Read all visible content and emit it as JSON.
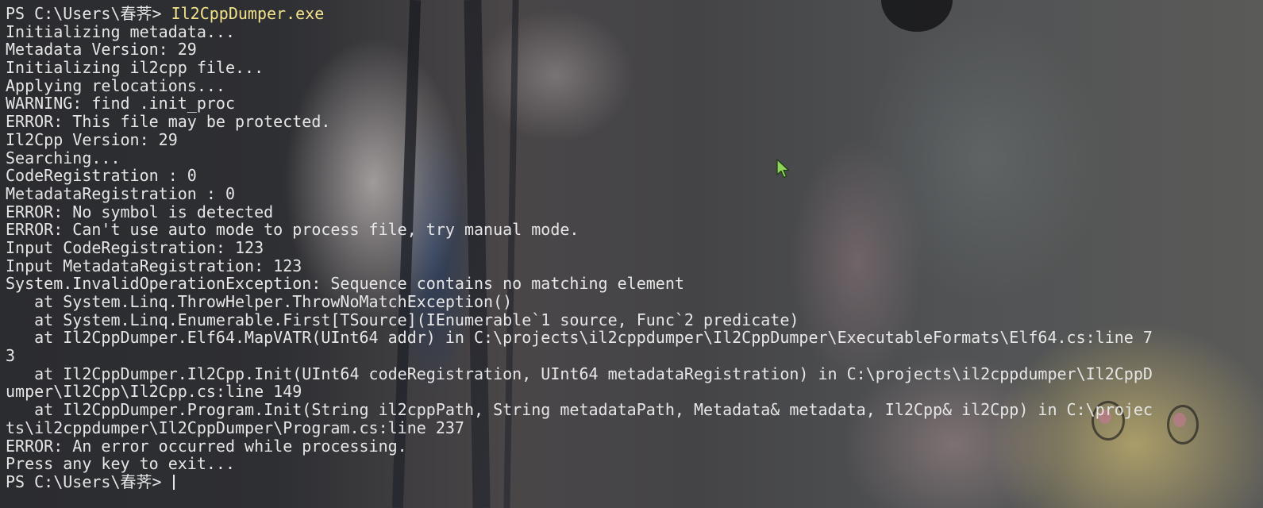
{
  "window": {
    "type": "PowerShell terminal"
  },
  "terminal": {
    "prompt": "PS C:\\Users\\春荠> ",
    "command": "Il2CppDumper.exe",
    "output": [
      "Initializing metadata...",
      "Metadata Version: 29",
      "Initializing il2cpp file...",
      "Applying relocations...",
      "WARNING: find .init_proc",
      "ERROR: This file may be protected.",
      "Il2Cpp Version: 29",
      "Searching...",
      "CodeRegistration : 0",
      "MetadataRegistration : 0",
      "ERROR: No symbol is detected",
      "ERROR: Can't use auto mode to process file, try manual mode.",
      "Input CodeRegistration: 123",
      "Input MetadataRegistration: 123",
      "System.InvalidOperationException: Sequence contains no matching element",
      "   at System.Linq.ThrowHelper.ThrowNoMatchException()",
      "   at System.Linq.Enumerable.First[TSource](IEnumerable`1 source, Func`2 predicate)",
      "   at Il2CppDumper.Elf64.MapVATR(UInt64 addr) in C:\\projects\\il2cppdumper\\Il2CppDumper\\ExecutableFormats\\Elf64.cs:line 7",
      "3",
      "   at Il2CppDumper.Il2Cpp.Init(UInt64 codeRegistration, UInt64 metadataRegistration) in C:\\projects\\il2cppdumper\\Il2CppD",
      "umper\\Il2Cpp\\Il2Cpp.cs:line 149",
      "   at Il2CppDumper.Program.Init(String il2cppPath, String metadataPath, Metadata& metadata, Il2Cpp& il2Cpp) in C:\\projec",
      "ts\\il2cppdumper\\Il2CppDumper\\Program.cs:line 237",
      "ERROR: An error occurred while processing.",
      "Press any key to exit..."
    ],
    "final_prompt": "PS C:\\Users\\春荠> ",
    "colors": {
      "text": "#e6e6e6",
      "command": "#f2e28a",
      "pointer_fill": "#8fd35a"
    }
  },
  "icons": {
    "pointer": "mouse-pointer-icon"
  }
}
